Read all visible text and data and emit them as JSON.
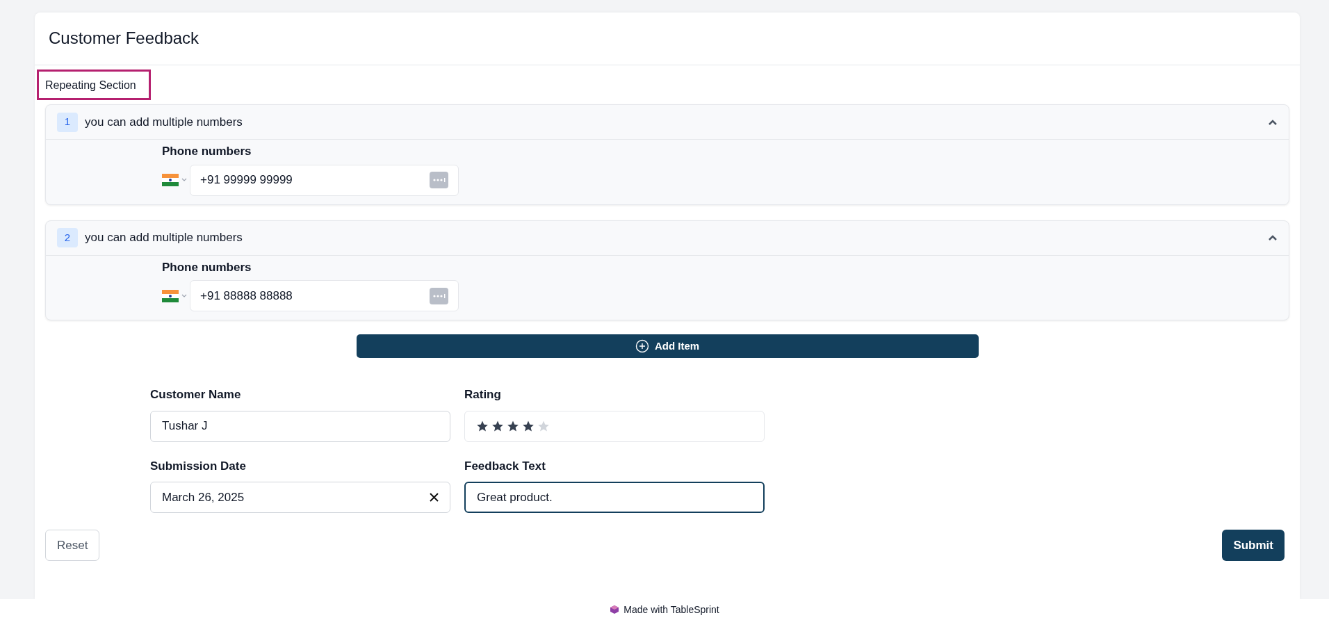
{
  "page": {
    "title": "Customer Feedback"
  },
  "repeating_section": {
    "label": "Repeating Section",
    "highlighted": true,
    "items": [
      {
        "index": "1",
        "title": "you can add multiple numbers",
        "expanded": true,
        "field_label": "Phone numbers",
        "phone": "+91 99999 99999"
      },
      {
        "index": "2",
        "title": "you can add multiple numbers",
        "expanded": true,
        "field_label": "Phone numbers",
        "phone": "+91 88888 88888"
      }
    ],
    "add_button": "Add Item"
  },
  "fields": [
    {
      "kind": "text",
      "label": "Customer Name",
      "value": "Tushar J",
      "focused": false
    },
    {
      "kind": "rating",
      "label": "Rating",
      "stars": 4
    },
    {
      "kind": "date",
      "label": "Submission Date",
      "value": "March 26, 2025"
    },
    {
      "kind": "text",
      "label": "Feedback Text",
      "value": "Great product.",
      "focused": true
    }
  ],
  "buttons": {
    "reset": "Reset",
    "submit": "Submit"
  },
  "footer": "Made with TableSprint"
}
